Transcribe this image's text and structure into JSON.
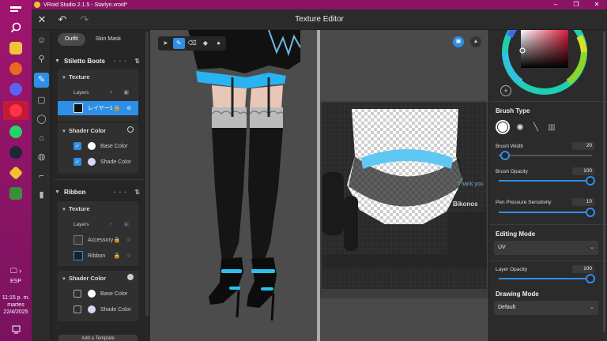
{
  "window": {
    "title": "VRoid Studio 2.1.5 - Starlyn.vroid*",
    "controls": [
      "–",
      "❐",
      "✕"
    ]
  },
  "taskbar": {
    "lang": "ESP",
    "time": "11:15 p. m.",
    "day": "martes",
    "date": "22/4/2025",
    "icons": [
      {
        "name": "start-menu-icon",
        "glyph": "▬",
        "color": "#ffffff"
      },
      {
        "name": "search-icon",
        "glyph": "⌕",
        "color": "#ffffff"
      },
      {
        "name": "file-explorer-icon",
        "glyph": "",
        "color": "#f3c43a"
      },
      {
        "name": "firefox-icon",
        "glyph": "",
        "color": "#e66a24"
      },
      {
        "name": "discord-icon",
        "glyph": "",
        "color": "#5865f2"
      },
      {
        "name": "opera-icon",
        "glyph": "",
        "color": "#e0202f"
      },
      {
        "name": "whatsapp-icon",
        "glyph": "9",
        "color": "#25d366"
      },
      {
        "name": "steam-icon",
        "glyph": "",
        "color": "#1b2838"
      },
      {
        "name": "vroid-icon",
        "glyph": "",
        "color": "#f2c12e"
      },
      {
        "name": "app-icon",
        "glyph": "",
        "color": "#3a8f3a"
      }
    ]
  },
  "header": {
    "title": "Texture Editor",
    "close": "✕",
    "undo": "↶",
    "redo": "↷"
  },
  "rail": [
    {
      "name": "rail-face-icon",
      "glyph": "☺"
    },
    {
      "name": "rail-hair-icon",
      "glyph": "⚲"
    },
    {
      "name": "rail-body-icon",
      "glyph": "◯"
    },
    {
      "name": "rail-brush-icon",
      "glyph": "✎"
    },
    {
      "name": "rail-outfit-icon",
      "glyph": "▢"
    },
    {
      "name": "rail-accessory-icon",
      "glyph": "⌂"
    },
    {
      "name": "rail-look-icon",
      "glyph": "◍"
    },
    {
      "name": "rail-pose-icon",
      "glyph": "⌐"
    },
    {
      "name": "rail-misc-icon",
      "glyph": "▮"
    }
  ],
  "left_panel": {
    "tabs": [
      "Outfit",
      "Skin Mask"
    ],
    "groups": [
      {
        "title": "Stiletto Boots",
        "texture_title": "Texture",
        "layers_label": "Layers",
        "layers": [
          "レイヤー1"
        ],
        "shader_title": "Shader Color",
        "shader": [
          {
            "label": "Base Color",
            "color": "#ffffff",
            "checked": true
          },
          {
            "label": "Shade Color",
            "color": "#d8d6f2",
            "checked": true
          }
        ]
      },
      {
        "title": "Ribbon",
        "texture_title": "Texture",
        "layers_label": "Layers",
        "layers": [
          "Accessory",
          "Ribbon"
        ],
        "shader_title": "Shader Color",
        "shader": [
          {
            "label": "Base Color",
            "color": "#ffffff",
            "checked": false
          },
          {
            "label": "Shade Color",
            "color": "#d8d6f2",
            "checked": false
          }
        ]
      }
    ],
    "add_template": "Add a Template"
  },
  "uv": {
    "thank_you": "Thank you",
    "name": "Bikonos"
  },
  "right_panel": {
    "brush_type_title": "Brush Type",
    "brush_width_label": "Brush Width",
    "brush_width": 20,
    "brush_opacity_label": "Brush Opacity",
    "brush_opacity": 100,
    "pen_pressure_label": "Pen Pressure Sensitivity",
    "pen_pressure": 10,
    "editing_mode_title": "Editing Mode",
    "editing_mode": "UV",
    "layer_opacity_label": "Layer Opacity",
    "layer_opacity": 100,
    "drawing_mode_title": "Drawing Mode",
    "drawing_mode": "Default",
    "accent": "#2f8fe8"
  }
}
